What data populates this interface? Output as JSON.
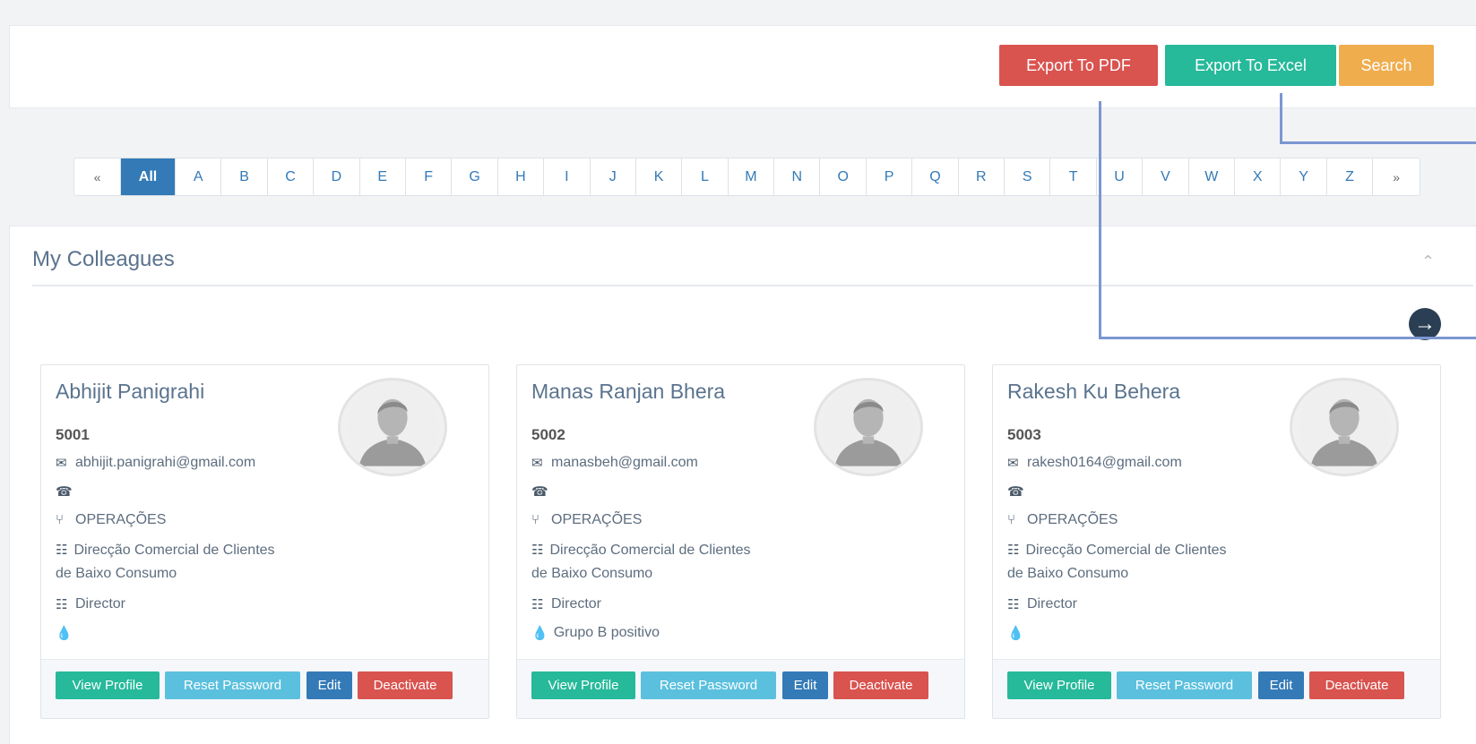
{
  "toolbar": {
    "export_pdf": "Export To PDF",
    "export_excel": "Export To Excel",
    "search": "Search"
  },
  "pager": {
    "prev": "«",
    "all": "All",
    "letters": [
      "A",
      "B",
      "C",
      "D",
      "E",
      "F",
      "G",
      "H",
      "I",
      "J",
      "K",
      "L",
      "M",
      "N",
      "O",
      "P",
      "Q",
      "R",
      "S",
      "T",
      "U",
      "V",
      "W",
      "X",
      "Y",
      "Z"
    ],
    "next": "»",
    "active": "All"
  },
  "panel": {
    "title": "My Colleagues"
  },
  "cards": [
    {
      "name": "Abhijit Panigrahi",
      "id": "5001",
      "email": "abhijit.panigrahi@gmail.com",
      "phone": "",
      "department": "OPERAÇÕES",
      "division": "Direcção Comercial de Clientes de Baixo Consumo",
      "role": "Director",
      "blood_group": ""
    },
    {
      "name": "Manas Ranjan Bhera",
      "id": "5002",
      "email": "manasbeh@gmail.com",
      "phone": "",
      "department": "OPERAÇÕES",
      "division": "Direcção Comercial de Clientes de Baixo Consumo",
      "role": "Director",
      "blood_group": "Grupo B positivo"
    },
    {
      "name": "Rakesh Ku Behera",
      "id": "5003",
      "email": "rakesh0164@gmail.com",
      "phone": "",
      "department": "OPERAÇÕES",
      "division": "Direcção Comercial de Clientes de Baixo Consumo",
      "role": "Director",
      "blood_group": ""
    }
  ],
  "card_actions": {
    "view": "View Profile",
    "reset": "Reset Password",
    "edit": "Edit",
    "deactivate": "Deactivate"
  },
  "icons": {
    "email": "envelope-icon",
    "phone": "phone-icon",
    "department": "branch-icon",
    "division": "sitemap-icon",
    "role": "id-card-icon",
    "blood": "drop-icon",
    "collapse": "chevron-up-icon",
    "next": "arrow-right-circle-icon"
  },
  "colors": {
    "danger": "#d9534f",
    "success": "#26b99a",
    "warning": "#f0ad4e",
    "info": "#5bc0de",
    "primary": "#337ab7",
    "title": "#5a738e",
    "annotation": "#7b97d1"
  }
}
